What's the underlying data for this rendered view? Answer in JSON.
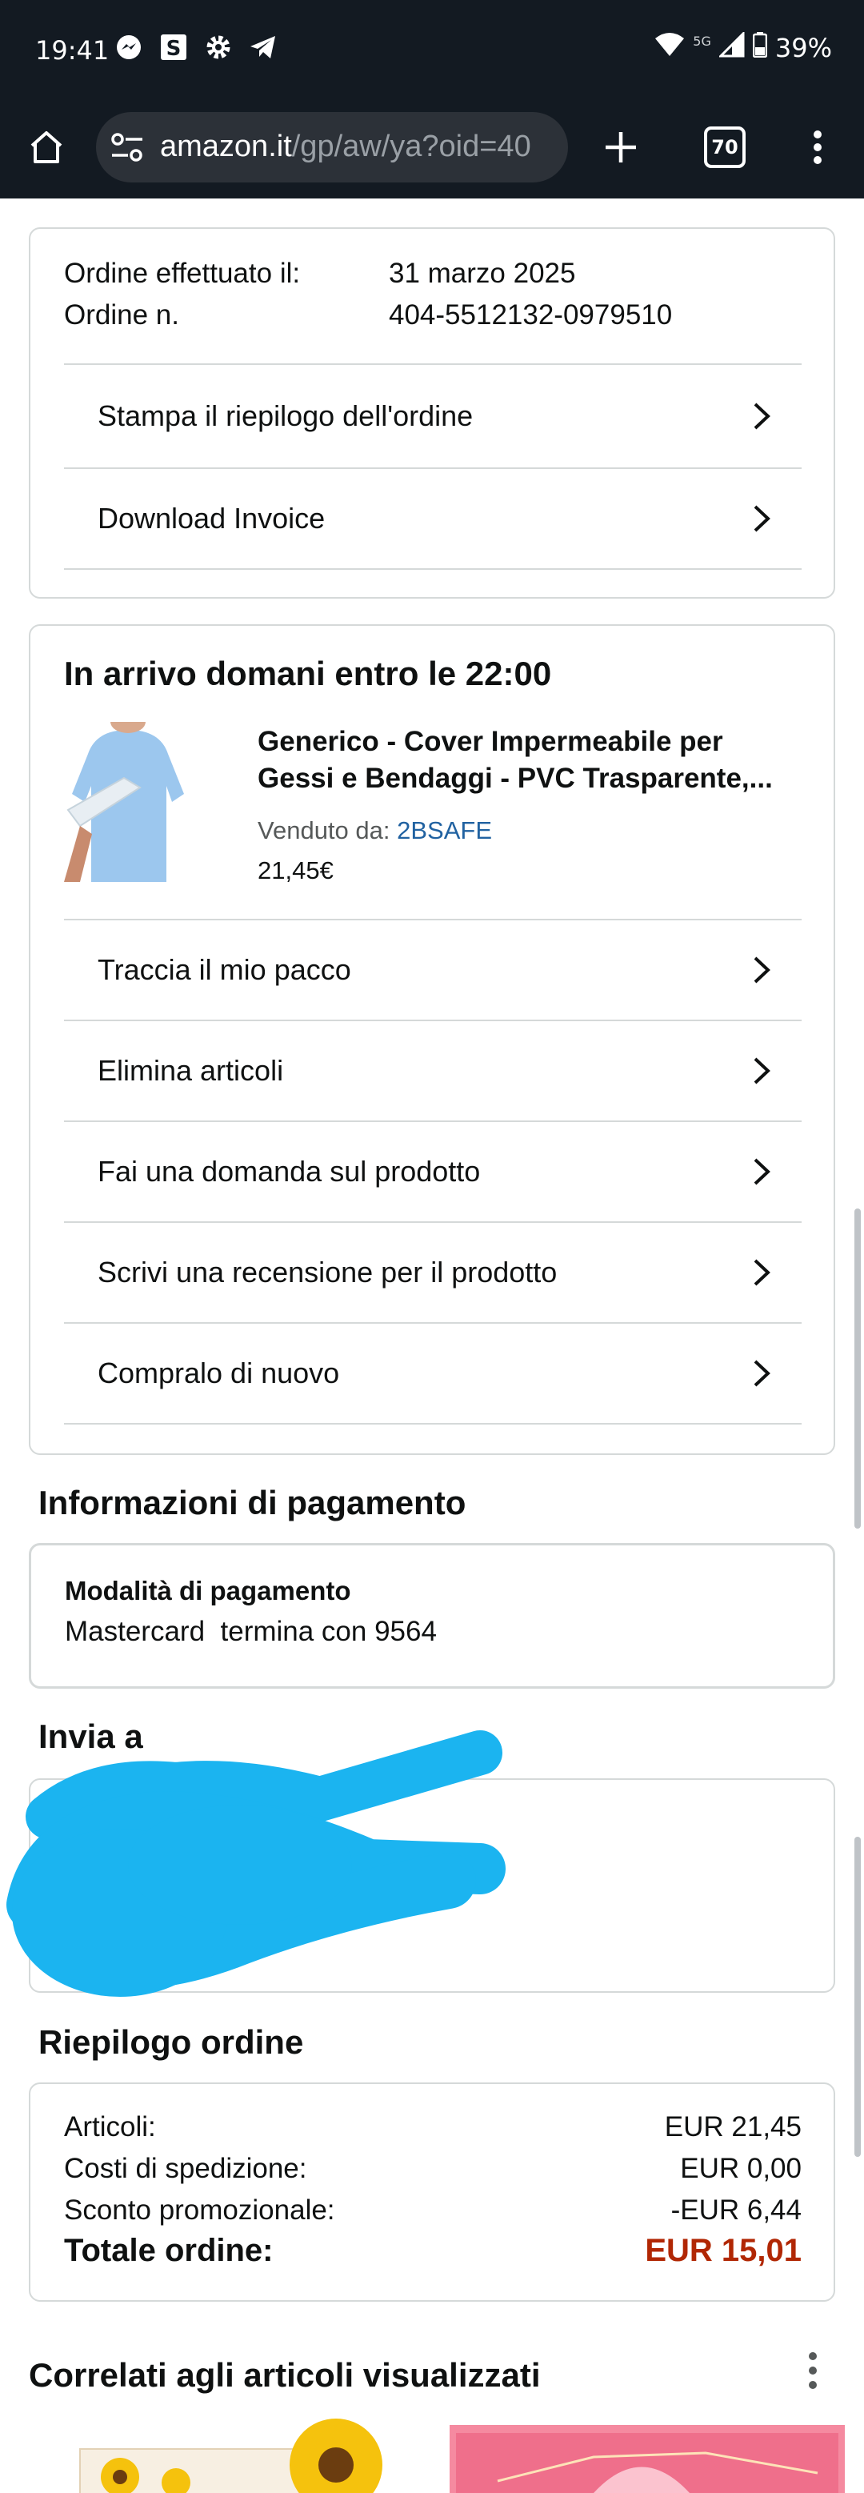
{
  "status_bar": {
    "time": "19:41",
    "network": "5G",
    "battery": "39%",
    "icons": [
      "messenger-icon",
      "s-app-icon",
      "settings-gear-icon",
      "telegram-icon",
      "wifi-icon",
      "signal-icon",
      "battery-icon"
    ]
  },
  "browser": {
    "url_host": "amazon.it",
    "url_path": "/gp/aw/ya?oid=40",
    "tab_count": "70",
    "icons": [
      "home-icon",
      "site-settings-icon",
      "new-tab-plus-icon",
      "tab-switcher-icon",
      "overflow-menu-icon"
    ]
  },
  "order_info": {
    "date_label": "Ordine effettuato il:",
    "date_value": "31 marzo 2025",
    "number_label": "Ordine n.",
    "number_value": "404-5512132-0979510",
    "actions": [
      "Stampa il riepilogo dell'ordine",
      "Download Invoice"
    ]
  },
  "shipment": {
    "heading": "In arrivo domani entro le 22:00",
    "product_title_line1": "Generico - Cover Impermeabile per",
    "product_title_line2": "Gessi e Bendaggi - PVC Trasparente,...",
    "sold_by_label": "Venduto da:",
    "seller": "2BSAFE",
    "price": "21,45€",
    "actions": [
      "Traccia il mio pacco",
      "Elimina articoli",
      "Fai una domanda sul prodotto",
      "Scrivi una recensione per il prodotto",
      "Compralo di nuovo"
    ]
  },
  "payment": {
    "heading": "Informazioni di pagamento",
    "method_label": "Modalità di pagamento",
    "method_value": "Mastercard  termina con 9564"
  },
  "ship_to": {
    "heading": "Invia a"
  },
  "summary": {
    "heading": "Riepilogo ordine",
    "items_label": "Articoli:",
    "items_value": "EUR 21,45",
    "shipping_label": "Costi di spedizione:",
    "shipping_value": "EUR 0,00",
    "discount_label": "Sconto promozionale:",
    "discount_value": "-EUR 6,44",
    "total_label": "Totale ordine:",
    "total_value": "EUR 15,01"
  },
  "related": {
    "heading": "Correlati agli articoli visualizzati"
  },
  "colors": {
    "chrome_bg": "#131a22",
    "link": "#2162a1",
    "total_red": "#b12704",
    "redaction": "#1bb4f0"
  }
}
